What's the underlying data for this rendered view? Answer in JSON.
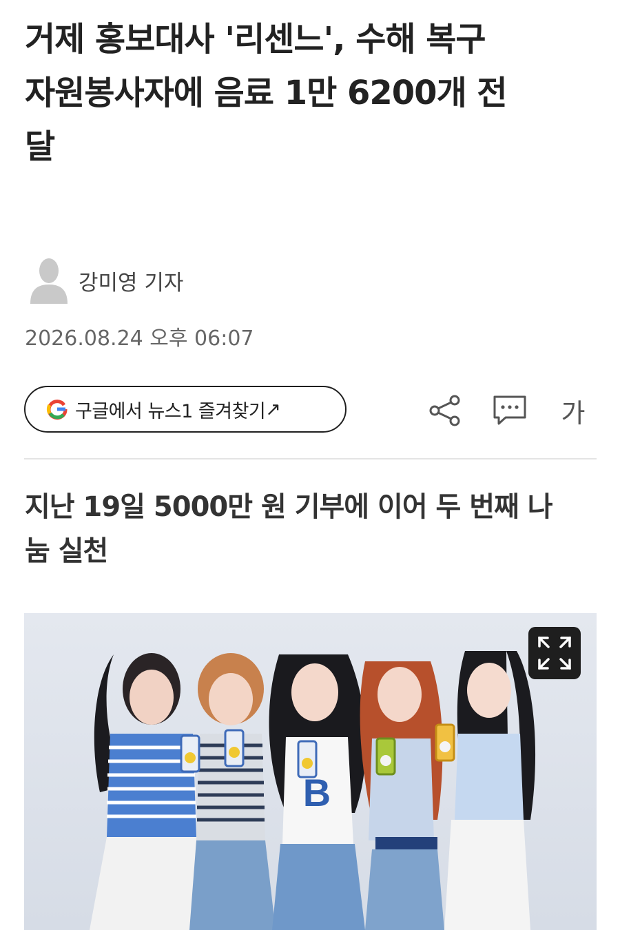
{
  "article": {
    "headline_lines": [
      "거제 홍보대사 '리센느', 수해 복구",
      "자원봉사자에 음료 1만 6200개 전",
      "달"
    ],
    "subheadline_lines": [
      "지난 19일 5000만 원 기부에 이어 두 번째 나",
      "눔 실천"
    ]
  },
  "author": {
    "name": "강미영 기자",
    "avatar_icon": "person-silhouette-icon"
  },
  "published": "2026.08.24 오후 06:07",
  "toolbar": {
    "google_follow_label": "구글에서 뉴스1 즐겨찾기",
    "google_follow_arrow": "↗",
    "google_icon": "google-g-icon",
    "share_icon": "share-icon",
    "comment_icon": "comment-icon",
    "font_size_label": "가"
  },
  "photo": {
    "expand_icon": "expand-icon",
    "people": 5
  },
  "colors": {
    "headline": "#222222",
    "meta_text": "#666666",
    "divider": "#e4e4e4",
    "photo_background": "#dde2eb",
    "expand_button": "#1e1e1e"
  }
}
